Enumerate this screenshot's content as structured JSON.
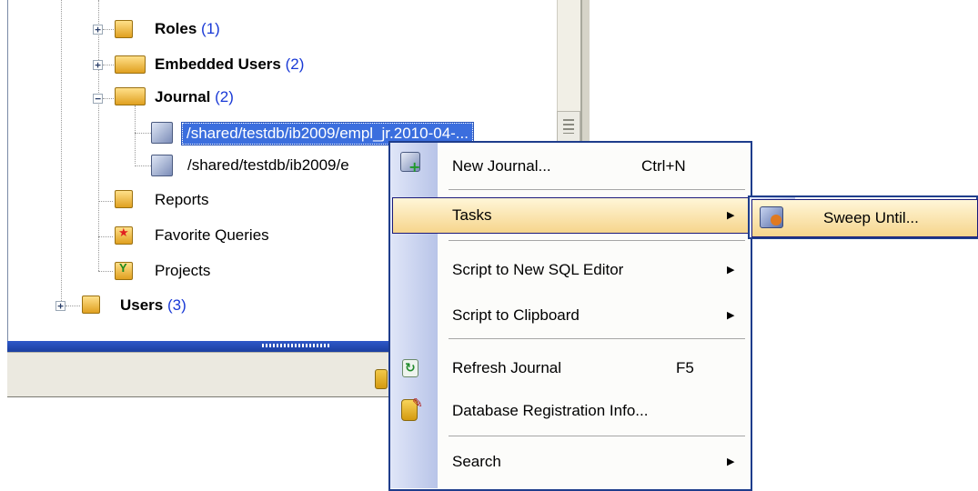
{
  "tree": {
    "roles": {
      "label": "Roles",
      "count": "(1)"
    },
    "embedded_users": {
      "label": "Embedded Users",
      "count": "(2)"
    },
    "journal": {
      "label": "Journal",
      "count": "(2)"
    },
    "journal_items": [
      {
        "label": "/shared/testdb/ib2009/empl_jr.2010-04-..."
      },
      {
        "label": "/shared/testdb/ib2009/e"
      }
    ],
    "reports": {
      "label": "Reports"
    },
    "favorite_queries": {
      "label": "Favorite Queries"
    },
    "projects": {
      "label": "Projects"
    },
    "users": {
      "label": "Users",
      "count": "(3)"
    }
  },
  "context_menu": {
    "new_journal": {
      "label": "New Journal...",
      "shortcut": "Ctrl+N"
    },
    "tasks": {
      "label": "Tasks"
    },
    "script_new_sql": {
      "label": "Script to New SQL Editor"
    },
    "script_clipboard": {
      "label": "Script to Clipboard"
    },
    "refresh_journal": {
      "label": "Refresh Journal",
      "shortcut": "F5"
    },
    "db_reg_info": {
      "label": "Database Registration Info..."
    },
    "search": {
      "label": "Search"
    }
  },
  "submenu": {
    "sweep_until": {
      "label": "Sweep Until..."
    }
  },
  "icons": {
    "expander_plus": "+",
    "expander_minus": "−",
    "submenu_arrow": "▶"
  },
  "colors": {
    "selection": "#3b6ede",
    "count_text": "#1a3ad6",
    "menu_border": "#1e3d8c",
    "highlight_top": "#fff6d8",
    "highlight_bottom": "#f6d58c"
  }
}
